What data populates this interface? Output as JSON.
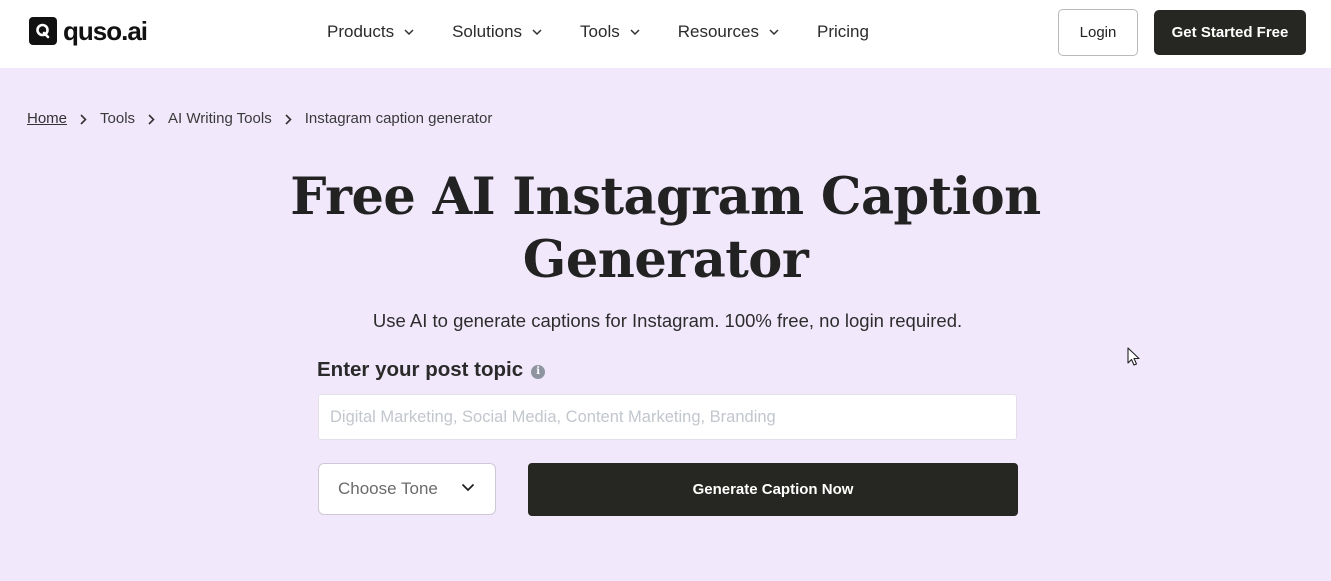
{
  "header": {
    "logo_text": "quso.ai",
    "nav": [
      {
        "label": "Products",
        "has_dropdown": true
      },
      {
        "label": "Solutions",
        "has_dropdown": true
      },
      {
        "label": "Tools",
        "has_dropdown": true
      },
      {
        "label": "Resources",
        "has_dropdown": true
      },
      {
        "label": "Pricing",
        "has_dropdown": false
      }
    ],
    "login_label": "Login",
    "get_started_label": "Get Started Free"
  },
  "breadcrumb": [
    {
      "label": "Home",
      "link": true
    },
    {
      "label": "Tools",
      "link": false
    },
    {
      "label": "AI Writing Tools",
      "link": false
    },
    {
      "label": "Instagram caption generator",
      "link": false
    }
  ],
  "hero": {
    "title_line1": "Free AI Instagram Caption",
    "title_line2": "Generator",
    "subtitle": "Use AI to generate captions for Instagram. 100% free, no login required."
  },
  "form": {
    "topic_label": "Enter your post topic",
    "info_icon": "info-icon",
    "topic_value": "",
    "topic_placeholder": "Digital Marketing, Social Media, Content Marketing, Branding",
    "tone_selected": "Choose Tone",
    "generate_label": "Generate Caption Now"
  },
  "colors": {
    "background": "#f1e8fb",
    "primary_button": "#262622",
    "header_bg": "#ffffff"
  }
}
